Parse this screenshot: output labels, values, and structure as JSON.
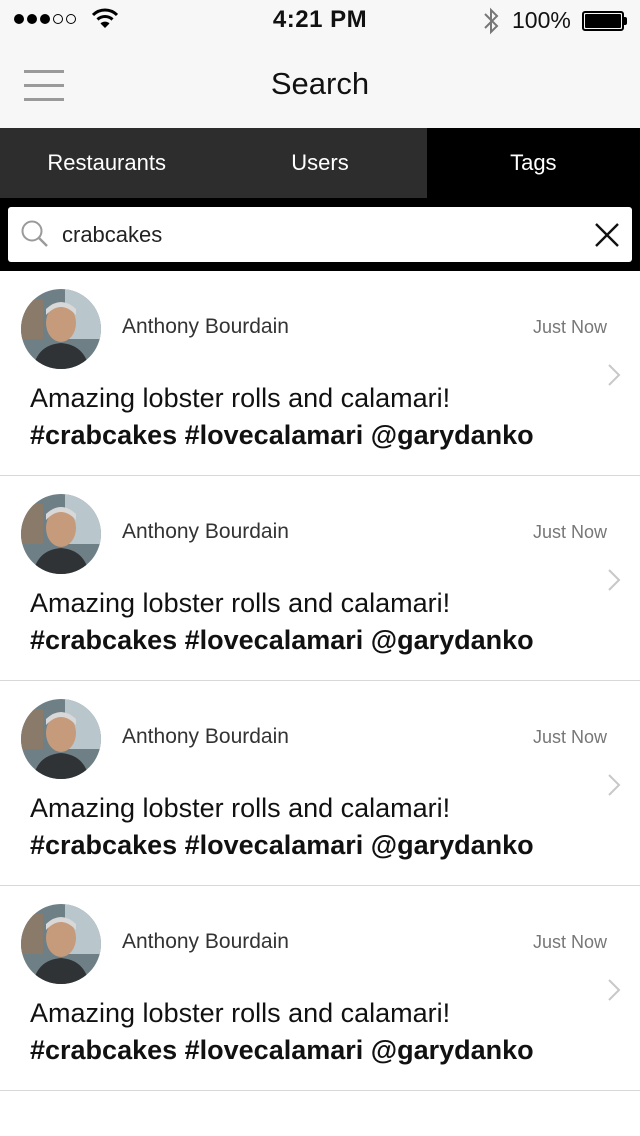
{
  "status_bar": {
    "time": "4:21 PM",
    "battery": "100%"
  },
  "nav": {
    "title": "Search"
  },
  "tabs": [
    {
      "label": "Restaurants",
      "active": false
    },
    {
      "label": "Users",
      "active": false
    },
    {
      "label": "Tags",
      "active": true
    }
  ],
  "search": {
    "value": "crabcakes"
  },
  "posts": [
    {
      "user": "Anthony Bourdain",
      "time": "Just Now",
      "text": "Amazing lobster rolls and calamari!",
      "tags": "#crabcakes #lovecalamari @garydanko"
    },
    {
      "user": "Anthony Bourdain",
      "time": "Just Now",
      "text": "Amazing lobster rolls and calamari!",
      "tags": "#crabcakes #lovecalamari @garydanko"
    },
    {
      "user": "Anthony Bourdain",
      "time": "Just Now",
      "text": "Amazing lobster rolls and calamari!",
      "tags": "#crabcakes #lovecalamari @garydanko"
    },
    {
      "user": "Anthony Bourdain",
      "time": "Just Now",
      "text": "Amazing lobster rolls and calamari!",
      "tags": "#crabcakes #lovecalamari @garydanko"
    }
  ],
  "colors": {
    "tab_bar": "#2d2d2d",
    "tab_active": "#000000",
    "nav_bg": "#f7f7f7"
  },
  "icons": [
    "signal-dots-icon",
    "wifi-icon",
    "bluetooth-icon",
    "battery-icon",
    "hamburger-menu-icon",
    "search-icon",
    "close-icon",
    "chevron-right-icon",
    "avatar-photo"
  ]
}
